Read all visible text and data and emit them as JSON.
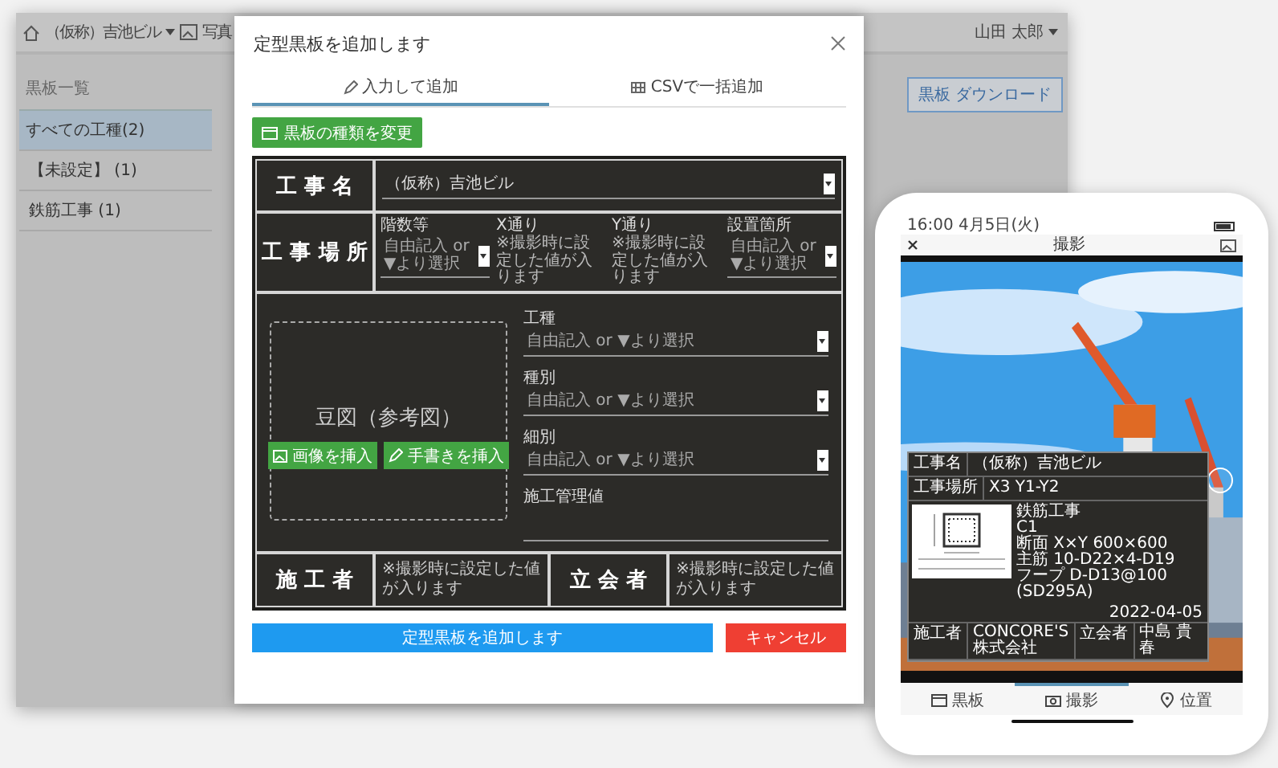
{
  "app": {
    "project": "（仮称）吉池ビル",
    "nav": [
      {
        "label": "写真"
      }
    ],
    "user": "山田 太郎",
    "sidebar_title": "黒板一覧",
    "sidebar": [
      {
        "label": "すべての工種(2)",
        "selected": true
      },
      {
        "label": "【未設定】 (1)",
        "selected": false
      },
      {
        "label": "鉄筋工事 (1)",
        "selected": false
      }
    ],
    "download_button": "黒板 ダウンロード"
  },
  "dialog": {
    "title": "定型黒板を追加します",
    "tabs": [
      {
        "label": "入力して追加",
        "selected": true
      },
      {
        "label": "CSVで一括追加",
        "selected": false
      }
    ],
    "change_type_button": "黒板の種類を変更",
    "board": {
      "project_label": "工 事 名",
      "project_value": "（仮称）吉池ビル",
      "location_label": "工 事 場 所",
      "location_fields": [
        {
          "kind": "select",
          "label": "階数等",
          "value": "自由記入 or ▼より選択"
        },
        {
          "kind": "note",
          "label": "X通り",
          "value": "※撮影時に設定した値が入ります"
        },
        {
          "kind": "note",
          "label": "Y通り",
          "value": "※撮影時に設定した値が入ります"
        },
        {
          "kind": "select",
          "label": "設置箇所",
          "value": "自由記入 or ▼より選択"
        }
      ],
      "sketch_title": "豆図（参考図）",
      "sketch_buttons": [
        "画像を挿入",
        "手書きを挿入"
      ],
      "fields": [
        {
          "kind": "select",
          "label": "工種",
          "value": "自由記入 or ▼より選択"
        },
        {
          "kind": "select",
          "label": "種別",
          "value": "自由記入 or ▼より選択"
        },
        {
          "kind": "select",
          "label": "細別",
          "value": "自由記入 or ▼より選択"
        },
        {
          "kind": "textarea",
          "label": "施工管理値"
        }
      ],
      "contractor_label": "施 工 者",
      "contractor_value": "※撮影時に設定した値が入ります",
      "witness_label": "立 会 者",
      "witness_value": "※撮影時に設定した値が入ります"
    },
    "submit_button": "定型黒板を追加します",
    "cancel_button": "キャンセル"
  },
  "phone": {
    "status_time": "16:00 4月5日(火)",
    "header_title": "撮影",
    "board": {
      "project_label": "工事名",
      "project_value": "（仮称）吉池ビル",
      "location_label": "工事場所",
      "location_value": "X3 Y1-Y2",
      "notes": [
        "鉄筋工事",
        "C1",
        "断面 X×Y 600×600",
        "主筋 10-D22×4-D19",
        "フープ D-D13@100 (SD295A)"
      ],
      "date": "2022-04-05",
      "contractor_label": "施工者",
      "contractor_value": "CONCORE'S株式会社",
      "witness_label": "立会者",
      "witness_value": "中島 貴春"
    },
    "tabs": [
      {
        "label": "黒板",
        "selected": false
      },
      {
        "label": "撮影",
        "selected": true
      },
      {
        "label": "位置",
        "selected": false
      }
    ]
  }
}
